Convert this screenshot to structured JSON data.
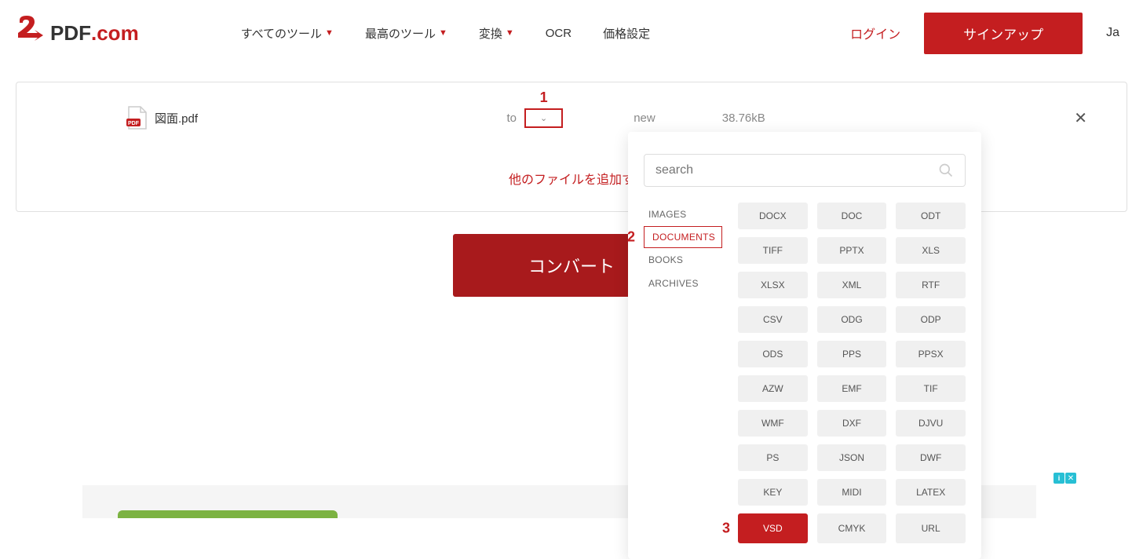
{
  "header": {
    "logo": {
      "text_pdf": "PDF",
      "text_com": ".com"
    },
    "nav": {
      "all_tools": "すべてのツール",
      "best_tools": "最高のツール",
      "convert": "変換",
      "ocr": "OCR",
      "pricing": "価格設定"
    },
    "login": "ログイン",
    "signup": "サインアップ",
    "lang": "Ja"
  },
  "file": {
    "name": "図面.pdf",
    "to": "to",
    "status": "new",
    "size": "38.76kB",
    "add_more": "他のファイルを追加す"
  },
  "convert_button": "コンバート",
  "dropdown": {
    "search_placeholder": "search",
    "categories": {
      "images": "IMAGES",
      "documents": "DOCUMENTS",
      "books": "BOOKS",
      "archives": "ARCHIVES"
    },
    "formats": [
      "DOCX",
      "DOC",
      "ODT",
      "TIFF",
      "PPTX",
      "XLS",
      "XLSX",
      "XML",
      "RTF",
      "CSV",
      "ODG",
      "ODP",
      "ODS",
      "PPS",
      "PPSX",
      "AZW",
      "EMF",
      "TIF",
      "WMF",
      "DXF",
      "DJVU",
      "PS",
      "JSON",
      "DWF",
      "KEY",
      "MIDI",
      "LATEX",
      "VSD",
      "CMYK",
      "URL"
    ],
    "selected_format": "VSD"
  },
  "annotations": {
    "one": "1",
    "two": "2",
    "three": "3"
  },
  "ad": {
    "i": "i",
    "x": "✕"
  }
}
